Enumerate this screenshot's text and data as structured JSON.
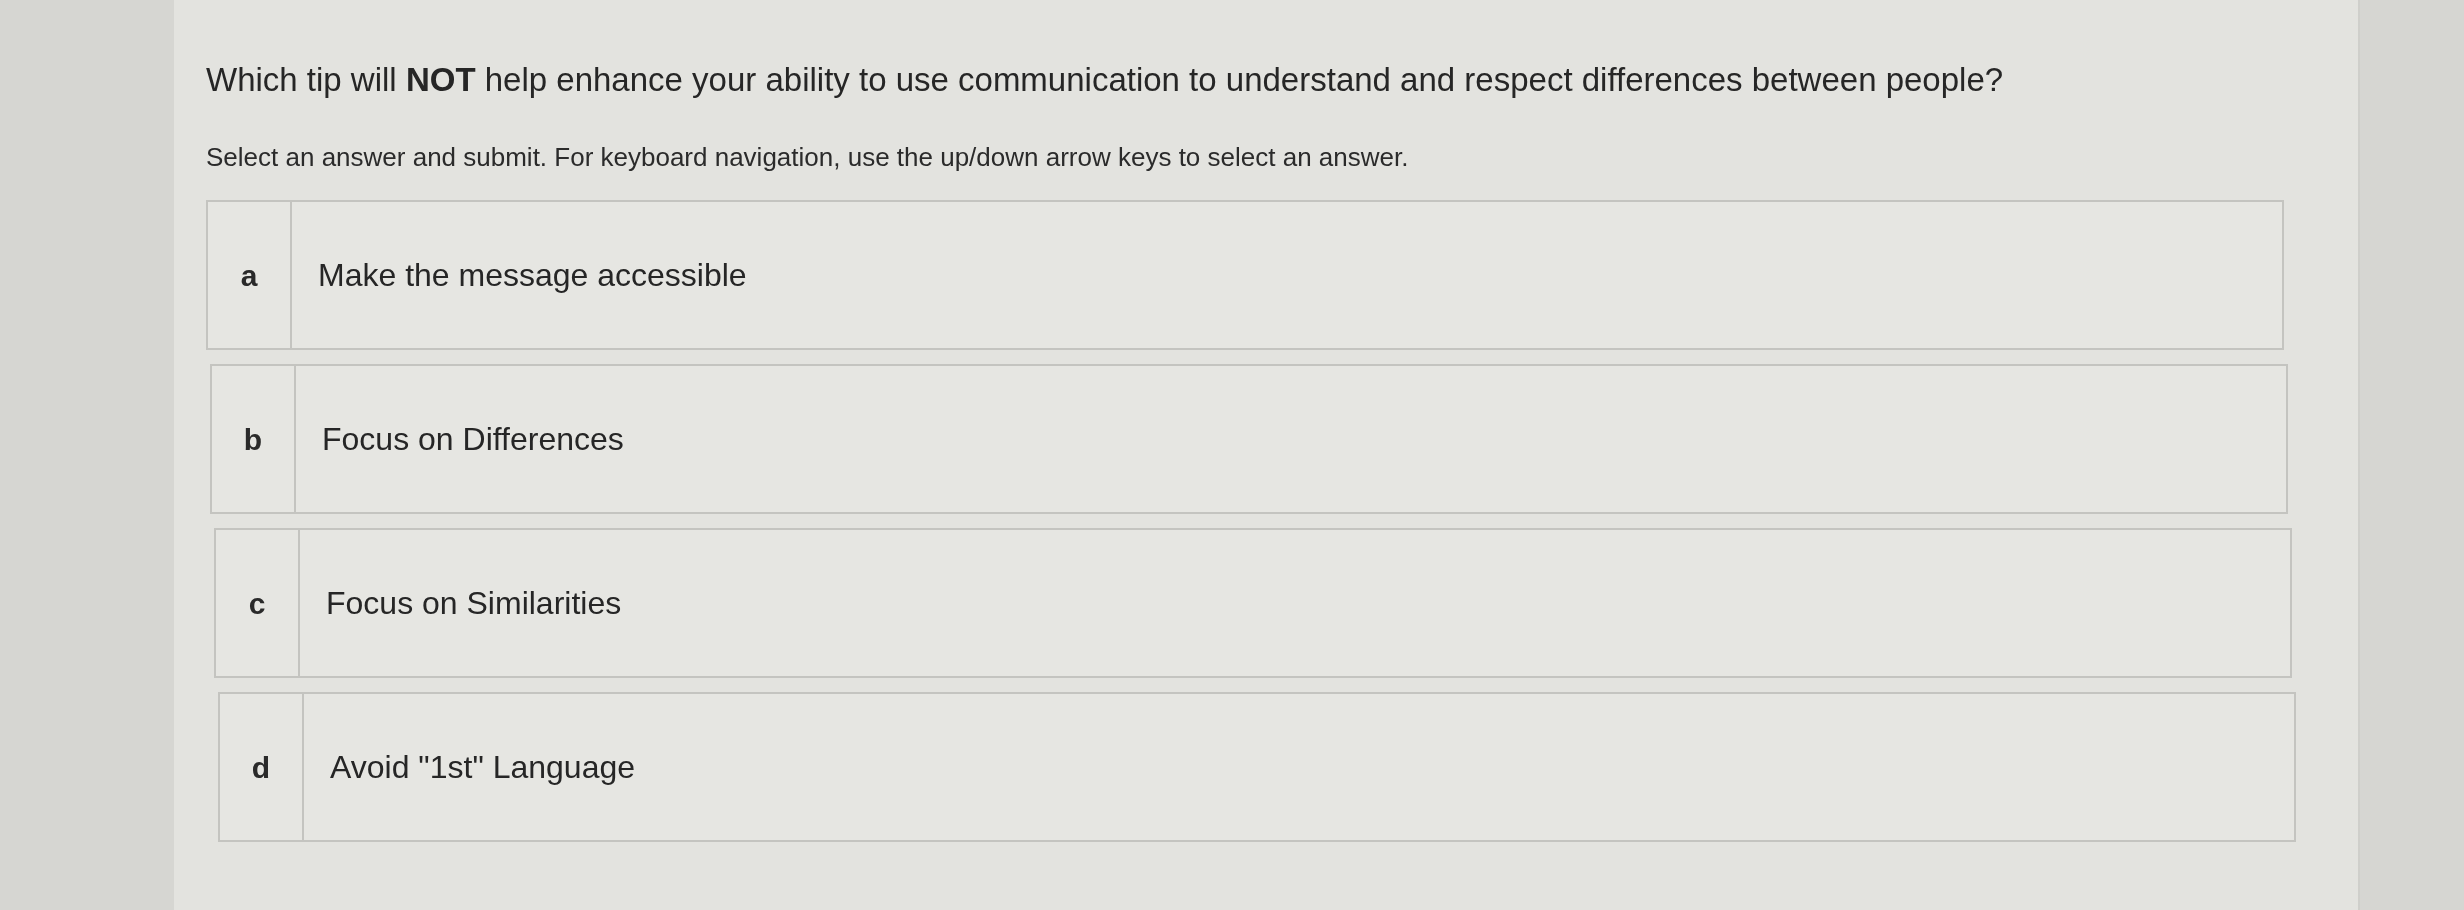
{
  "question": {
    "prompt": "Which tip will **NOT** help enhance your ability to use communication to understand and respect differences between people?",
    "instruction": "Select an answer and submit. For keyboard navigation, use the up/down arrow keys to select an answer."
  },
  "options": [
    {
      "letter": "a",
      "text": "Make the message accessible",
      "selected": false
    },
    {
      "letter": "b",
      "text": "Focus on Differences",
      "selected": false
    },
    {
      "letter": "c",
      "text": "Focus on Similarities",
      "selected": false
    },
    {
      "letter": "d",
      "text": "Avoid \"1st\" Language",
      "selected": false
    }
  ]
}
